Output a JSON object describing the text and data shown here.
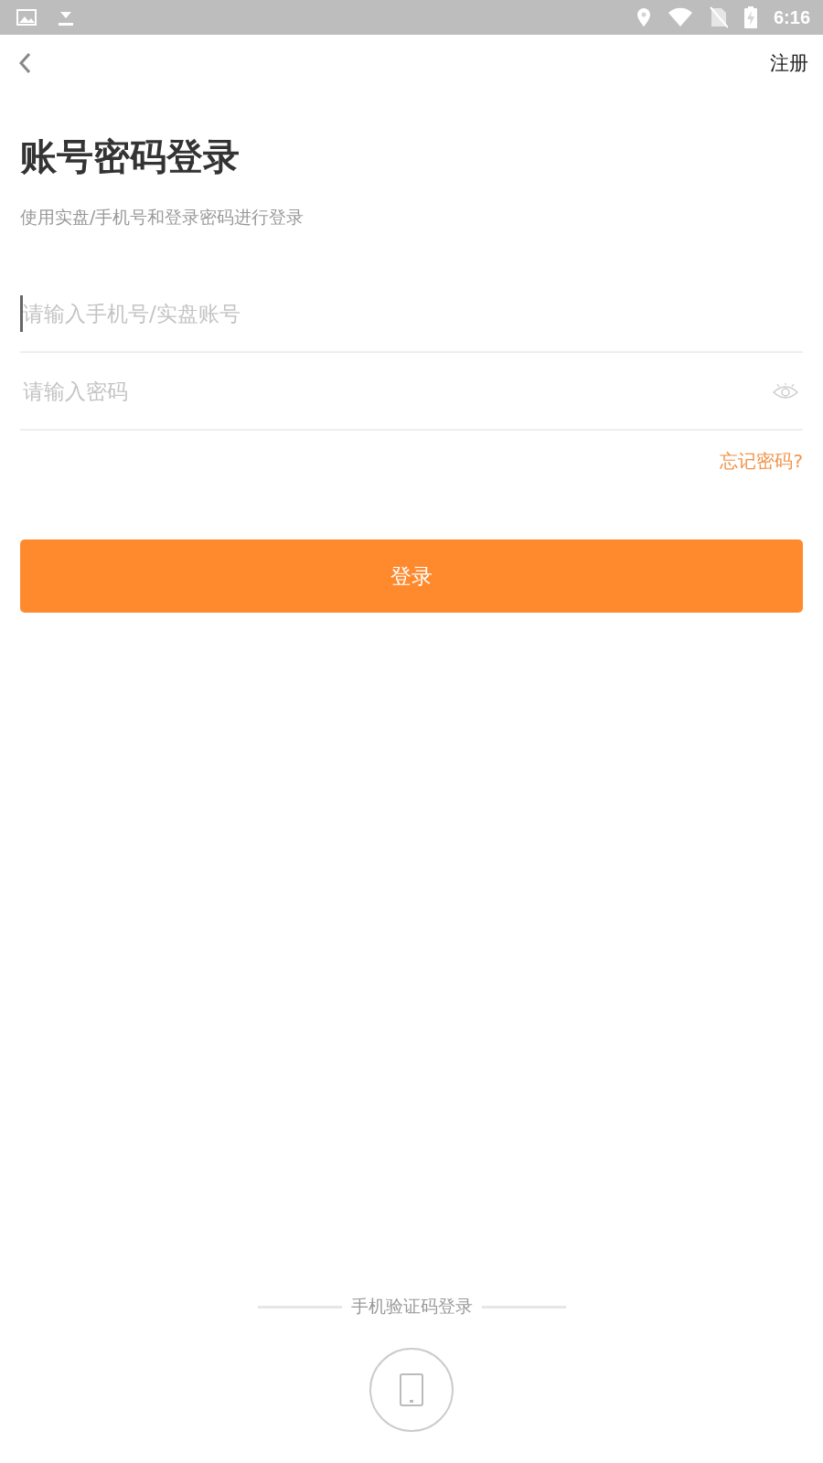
{
  "status_bar": {
    "time": "6:16"
  },
  "header": {
    "action": "注册"
  },
  "title": "账号密码登录",
  "subtitle": "使用实盘/手机号和登录密码进行登录",
  "fields": [
    {
      "kind": "text",
      "placeholder": "请输入手机号/实盘账号",
      "focused": true
    },
    {
      "kind": "password",
      "placeholder": "请输入密码",
      "focused": false
    }
  ],
  "forgot_link": "忘记密码?",
  "login_button": "登录",
  "alt_login": {
    "label": "手机验证码登录"
  }
}
